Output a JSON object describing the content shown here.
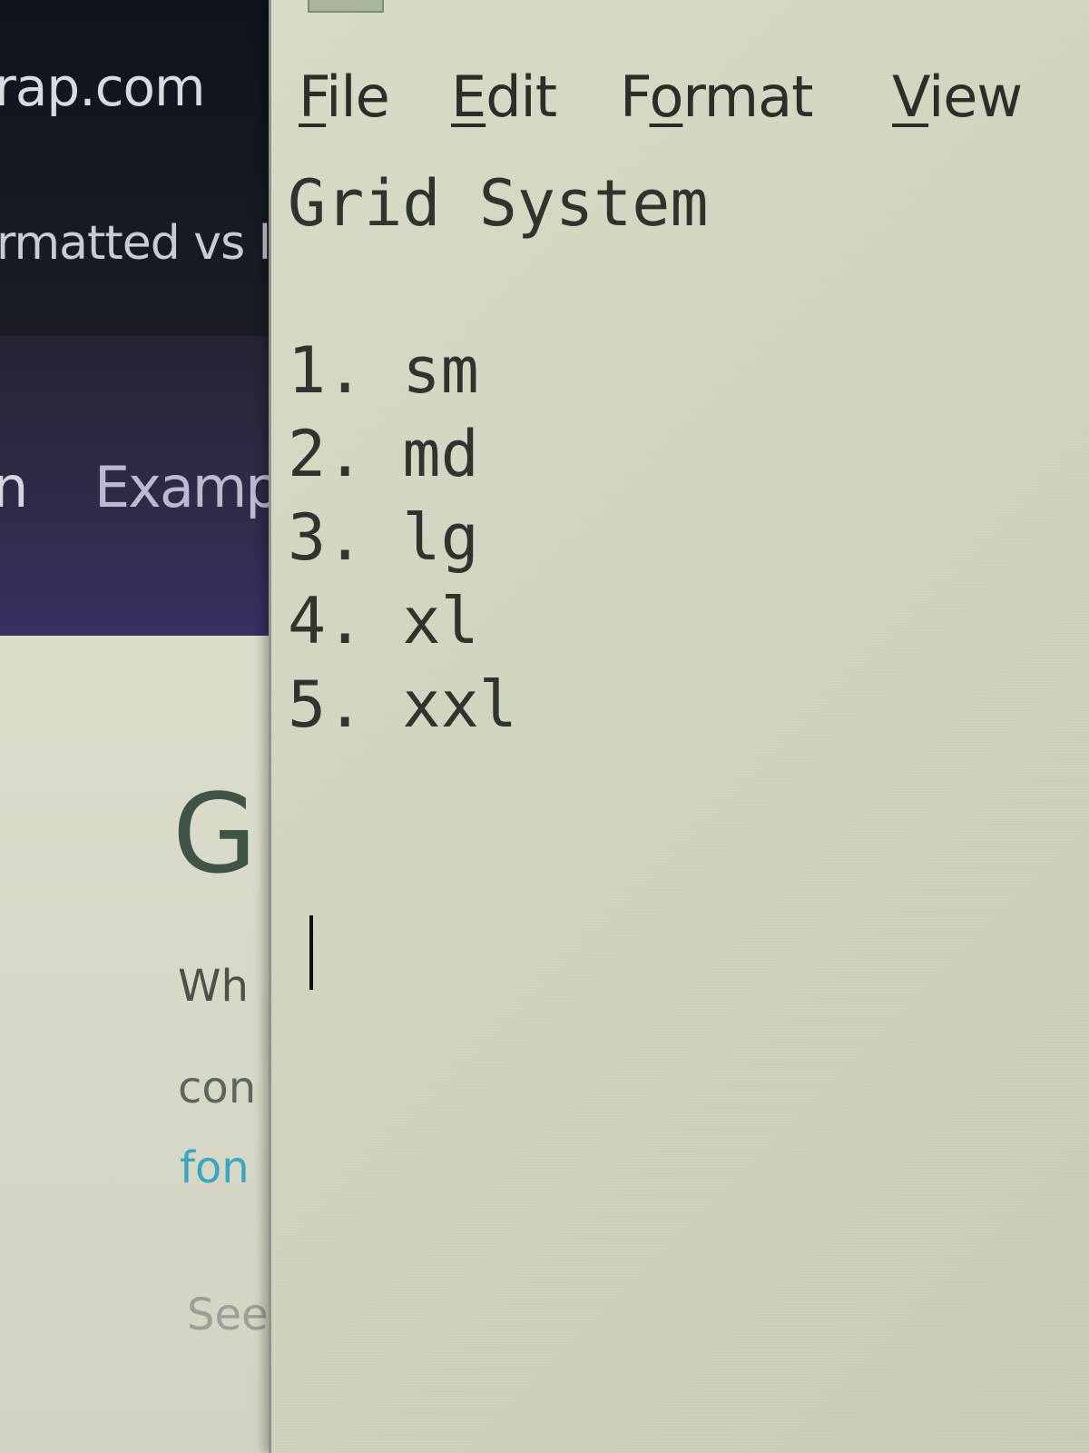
{
  "background_browser": {
    "url_fragment": "rap.com",
    "tab_title_fragment": "rmatted vs l",
    "nav_items": [
      "n",
      "Examp"
    ],
    "page_heading_fragment": "G",
    "paragraph_fragments": [
      "Wh",
      "con"
    ],
    "link_fragment": "fon",
    "see_also_fragment": "See"
  },
  "notepad": {
    "menu": [
      {
        "label_mnemonic": "F",
        "label_rest": "ile"
      },
      {
        "label_mnemonic": "E",
        "label_rest": "dit"
      },
      {
        "label_prefix": "F",
        "label_mnemonic": "o",
        "label_rest": "rmat"
      },
      {
        "label_mnemonic": "V",
        "label_rest": "iew"
      }
    ],
    "document_lines": [
      "Grid System",
      "",
      "1. sm",
      "2. md",
      "3. lg",
      "4. xl",
      "5. xxl"
    ]
  },
  "colors": {
    "notepad_background": "#cfd4bf",
    "text": "#30342f",
    "browser_header": "#141922",
    "browser_nav": "#2f2a47",
    "link": "#3aa7c1"
  }
}
